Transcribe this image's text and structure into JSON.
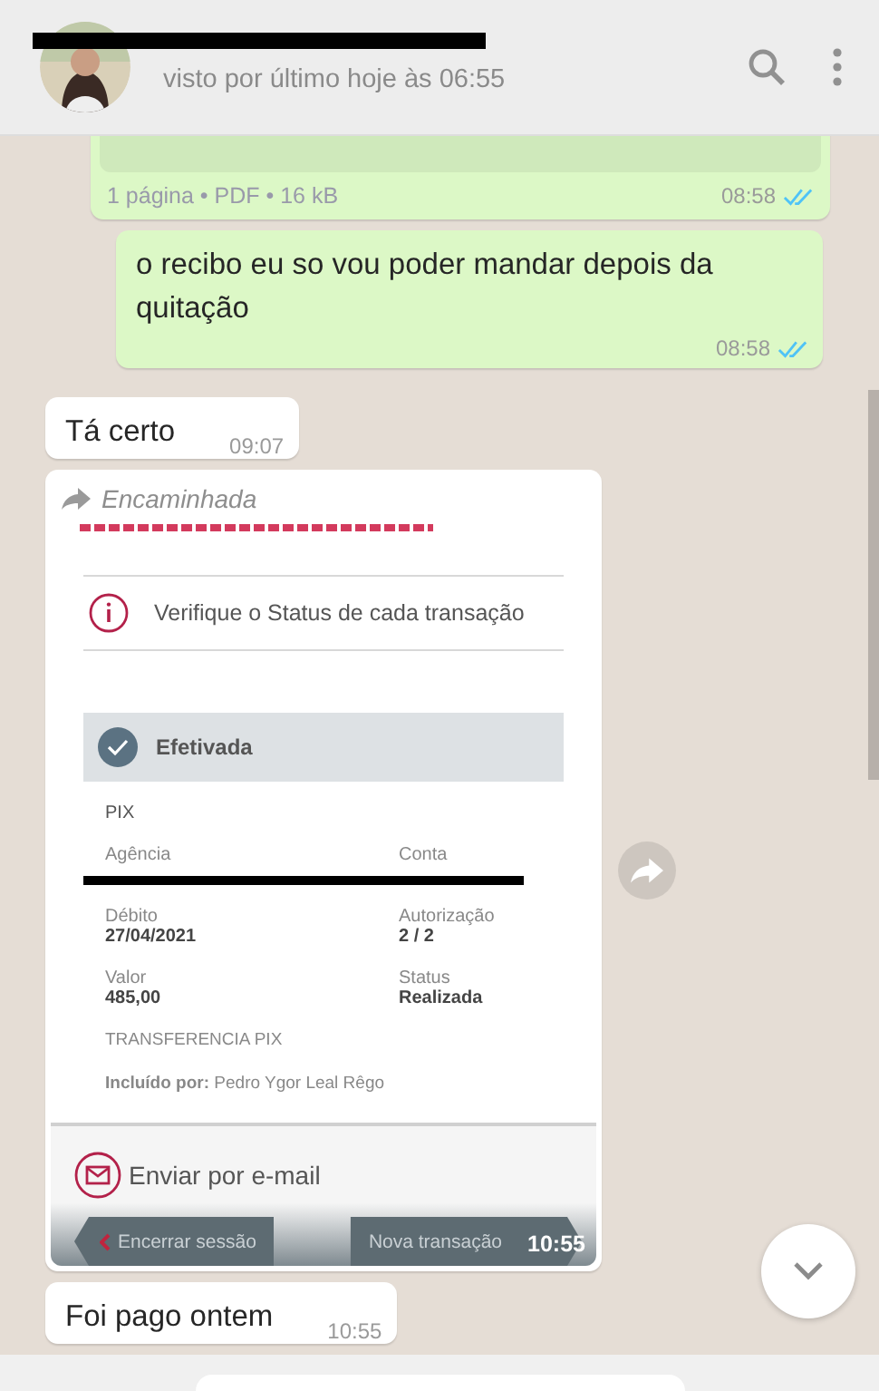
{
  "header": {
    "status": "visto por último hoje às 06:55"
  },
  "messages": [
    {
      "kind": "document",
      "outgoing": true,
      "meta": "1 página • PDF • 16 kB",
      "time": "08:58",
      "read": true
    },
    {
      "kind": "text",
      "outgoing": true,
      "text": "o recibo eu so vou poder mandar depois da quitação",
      "time": "08:58",
      "read": true
    },
    {
      "kind": "text",
      "outgoing": false,
      "text": "Tá certo",
      "time": "09:07"
    },
    {
      "kind": "receipt",
      "outgoing": false,
      "forwarded": "Encaminhada",
      "time": "10:55",
      "receipt": {
        "notice": "Verifique o Status de cada transação",
        "status": "Efetivada",
        "type": "PIX",
        "fields": [
          {
            "label": "Agência"
          },
          {
            "label": "Conta"
          },
          {
            "label": "Débito",
            "value": "27/04/2021"
          },
          {
            "label": "Autorização",
            "value": "2 / 2"
          },
          {
            "label": "Valor",
            "value": "485,00"
          },
          {
            "label": "Status",
            "value": "Realizada"
          }
        ],
        "description": "TRANSFERENCIA PIX",
        "included": "**Incluído por:** Pedro Ygor Leal Rêgo",
        "email": "Enviar por e-mail",
        "back": "Encerrar sessão",
        "next": "Nova transação"
      }
    },
    {
      "kind": "text",
      "outgoing": false,
      "text": "Foi pago ontem",
      "time": "10:55"
    }
  ]
}
